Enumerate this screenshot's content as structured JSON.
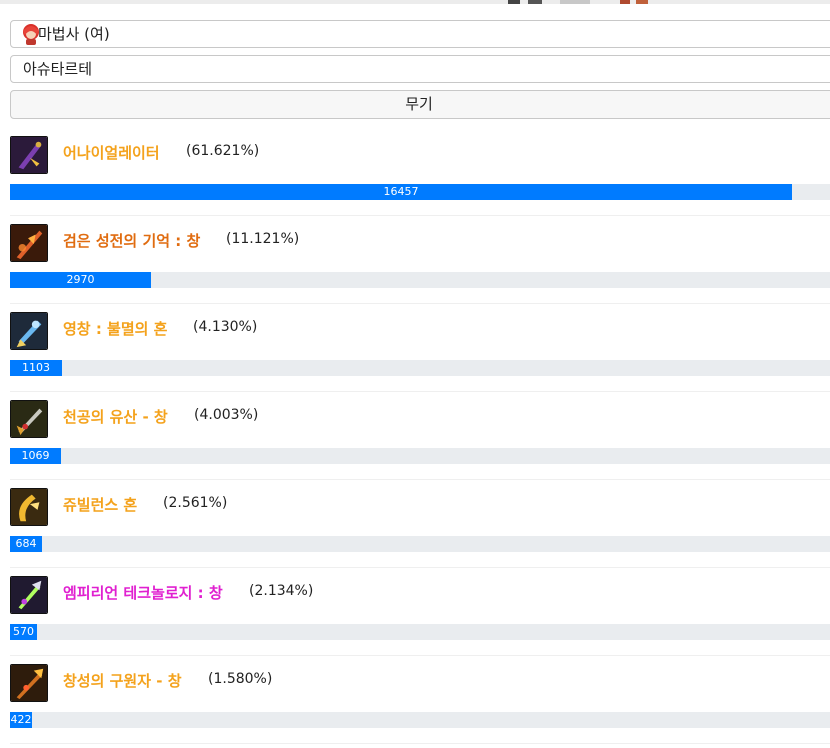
{
  "character_class": "마법사 (여)",
  "subclass": "아슈타르테",
  "category": "무기",
  "colors": {
    "bar": "#007bff",
    "track": "#e9ecef",
    "rarity_legendary": "#f4a21c",
    "rarity_unique": "#e06c10",
    "rarity_epic": "#e020d0"
  },
  "items": [
    {
      "name": "어나이얼레이터",
      "percent": "(61.621%)",
      "count": "16457",
      "ratio": 0.6162,
      "color": "#f4a21c",
      "icon": "purple-claw-weapon-icon"
    },
    {
      "name": "검은 성전의 기억 : 창",
      "percent": "(11.121%)",
      "count": "2970",
      "ratio": 0.1112,
      "color": "#e06c10",
      "icon": "flaming-spear-icon"
    },
    {
      "name": "영창 : 불멸의 혼",
      "percent": "(4.130%)",
      "count": "1103",
      "ratio": 0.0413,
      "color": "#f4a21c",
      "icon": "blue-crystal-blade-icon"
    },
    {
      "name": "천공의 유산 - 창",
      "percent": "(4.003%)",
      "count": "1069",
      "ratio": 0.04,
      "color": "#f4a21c",
      "icon": "sky-spear-icon"
    },
    {
      "name": "쥬빌런스 혼",
      "percent": "(2.561%)",
      "count": "684",
      "ratio": 0.0256,
      "color": "#f4a21c",
      "icon": "golden-horn-icon"
    },
    {
      "name": "엠피리언 테크놀로지 : 창",
      "percent": "(2.134%)",
      "count": "570",
      "ratio": 0.0213,
      "color": "#e020d0",
      "icon": "tech-spear-icon"
    },
    {
      "name": "창성의 구원자 - 창",
      "percent": "(1.580%)",
      "count": "422",
      "ratio": 0.0158,
      "color": "#f4a21c",
      "icon": "savior-spear-icon"
    }
  ]
}
